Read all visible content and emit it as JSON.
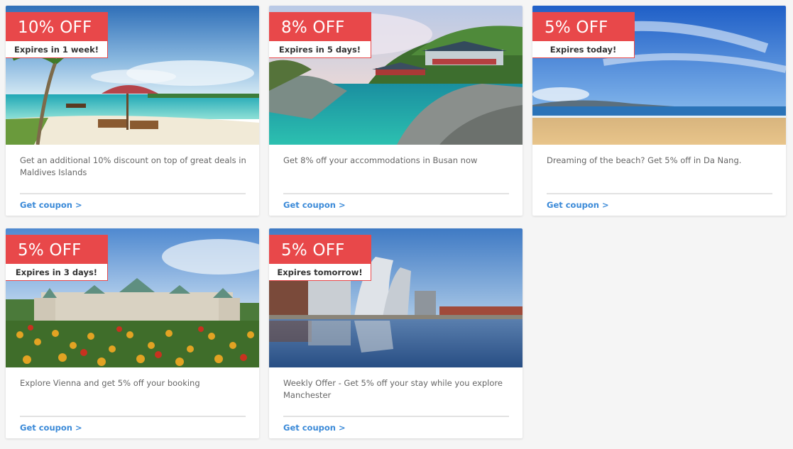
{
  "cards": [
    {
      "discount": "10% OFF",
      "expires": "Expires in 1 week!",
      "description": "Get an additional 10% discount on top of great deals in Maldives Islands",
      "cta": "Get coupon >",
      "image": "maldives-beach-photo"
    },
    {
      "discount": "8% OFF",
      "expires": "Expires in 5 days!",
      "description": "Get 8% off your accommodations in Busan now",
      "cta": "Get coupon >",
      "image": "busan-temple-coast-photo"
    },
    {
      "discount": "5% OFF",
      "expires": "Expires today!",
      "description": "Dreaming of the beach? Get 5% off in Da Nang.",
      "cta": "Get coupon >",
      "image": "da-nang-beach-photo"
    },
    {
      "discount": "5% OFF",
      "expires": "Expires in 3 days!",
      "description": "Explore Vienna and get 5% off your booking",
      "cta": "Get coupon >",
      "image": "vienna-palace-tulips-photo"
    },
    {
      "discount": "5% OFF",
      "expires": "Expires tomorrow!",
      "description": "Weekly Offer - Get 5% off your stay while you explore Manchester",
      "cta": "Get coupon >",
      "image": "manchester-waterfront-photo"
    }
  ],
  "colors": {
    "badge": "#e8484a",
    "link": "#3b8ad8",
    "text": "#666666"
  }
}
